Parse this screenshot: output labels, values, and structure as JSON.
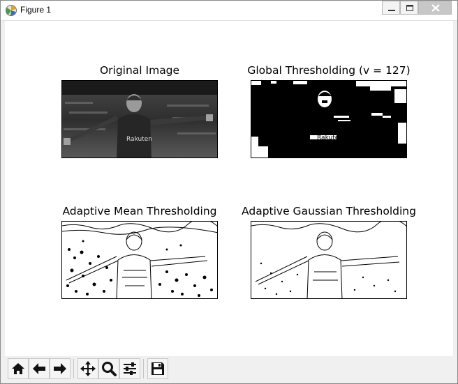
{
  "window": {
    "title": "Figure 1"
  },
  "figure": {
    "panels": [
      {
        "title": "Original Image",
        "style": "grayscale"
      },
      {
        "title": "Global Thresholding (v = 127)",
        "style": "binary"
      },
      {
        "title": "Adaptive Mean Thresholding",
        "style": "edges-dense"
      },
      {
        "title": "Adaptive Gaussian Thresholding",
        "style": "edges-light"
      }
    ],
    "jersey_text": "Rakuten"
  },
  "toolbar": {
    "buttons": [
      {
        "icon": "home-icon"
      },
      {
        "icon": "back-arrow-icon"
      },
      {
        "icon": "forward-arrow-icon"
      },
      {
        "icon": "pan-icon"
      },
      {
        "icon": "zoom-icon"
      },
      {
        "icon": "subplots-configure-icon"
      },
      {
        "icon": "save-icon"
      }
    ]
  }
}
